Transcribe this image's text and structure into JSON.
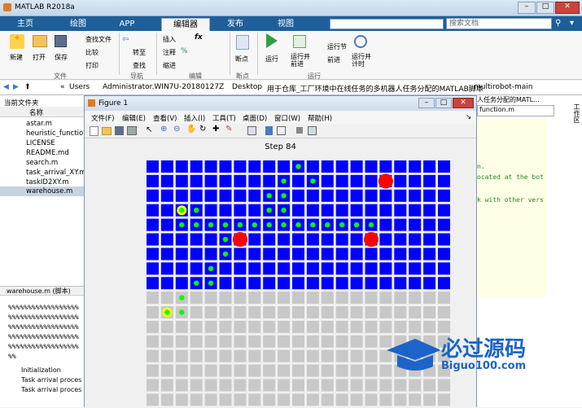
{
  "app": {
    "title": "MATLAB R2018a"
  },
  "tabs": [
    "主页",
    "绘图",
    "APP",
    "编辑器",
    "发布",
    "视图"
  ],
  "search": {
    "placeholder": "搜索文档"
  },
  "ribbon": {
    "new": "新建",
    "open": "打开",
    "save": "保存",
    "find_files": "查找文件",
    "compare": "比较",
    "print": "打印",
    "goto": "转至",
    "find": "查找",
    "insert": "插入",
    "comment": "注释",
    "indent": "缩进",
    "breakpoints": "断点",
    "run": "运行",
    "run_advance": "运行并\n前进",
    "run_section": "运行节",
    "advance": "前进",
    "run_time": "运行并\n计时",
    "groups": [
      "文件",
      "导航",
      "编辑",
      "断点",
      "运行"
    ]
  },
  "address": {
    "parts": [
      "«",
      "Users",
      "Administrator.WIN7U-20180127Z",
      "Desktop",
      "用于仓库_工厂环境中在线任务的多机器人任务分配的MATLAB脚本",
      "multirobot-main"
    ]
  },
  "current_folder": {
    "title": "当前文件夹",
    "column": "名称",
    "files": [
      "astar.m",
      "heuristic_function",
      "LICENSE",
      "README.md",
      "search.m",
      "task_arrival_XY.m",
      "taskID2XY.m",
      "warehouse.m"
    ],
    "selected": "warehouse.m"
  },
  "details": {
    "title": "warehouse.m (脚本)",
    "lines": [
      "%%%%%%%%%%%%%%%%%%",
      "%%%%%%%%%%%%%%%%%%",
      "%%%%%%%%%%%%%%%%%%",
      "%%%%%%%%%%%%%%%%%%",
      "%%%%%%%%%%%%%%%%%%",
      "%%"
    ],
    "sections": [
      "Initialization",
      "Task arrival proces",
      "Task arrival proces"
    ]
  },
  "figure": {
    "title": "Figure 1",
    "menu": [
      "文件(F)",
      "编辑(E)",
      "查看(V)",
      "插入(I)",
      "工具(T)",
      "桌面(D)",
      "窗口(W)",
      "帮助(H)"
    ],
    "plot_title": "Step 84"
  },
  "editor": {
    "tabs": [
      "function.m"
    ],
    "snippets": [
      "n.",
      "ocated at the bot",
      "k with other vers"
    ],
    "breadcrumb_tail": "人任务分配的MATL..."
  },
  "workspace": {
    "title": "工作区"
  },
  "watermark": {
    "text": "必过源码",
    "url": "Biguo100.com"
  },
  "colors": {
    "blue_cell": "#0000ff",
    "grey_cell": "#c8c8c8",
    "green_robot": "#00ff00",
    "yellow_robot": "#ffff00",
    "red_target": "#ff0000"
  },
  "grid": {
    "cols": 21,
    "blue_rows": 9,
    "grey_rows": 8,
    "green": [
      [
        11,
        1
      ],
      [
        10,
        2
      ],
      [
        12,
        2
      ],
      [
        9,
        3
      ],
      [
        10,
        3
      ],
      [
        4,
        4
      ],
      [
        9,
        4
      ],
      [
        10,
        4
      ],
      [
        3,
        5
      ],
      [
        4,
        5
      ],
      [
        5,
        5
      ],
      [
        6,
        5
      ],
      [
        7,
        5
      ],
      [
        8,
        5
      ],
      [
        9,
        5
      ],
      [
        10,
        5
      ],
      [
        11,
        5
      ],
      [
        12,
        5
      ],
      [
        13,
        5
      ],
      [
        14,
        5
      ],
      [
        15,
        5
      ],
      [
        16,
        5
      ],
      [
        6,
        6
      ],
      [
        6,
        7
      ],
      [
        5,
        8
      ],
      [
        4,
        9
      ],
      [
        5,
        9
      ],
      [
        3,
        10
      ],
      [
        3,
        11
      ]
    ],
    "yellow": [
      [
        3,
        4
      ],
      [
        2,
        11
      ]
    ],
    "red": [
      [
        17,
        2
      ],
      [
        7,
        6
      ],
      [
        16,
        6
      ]
    ]
  }
}
